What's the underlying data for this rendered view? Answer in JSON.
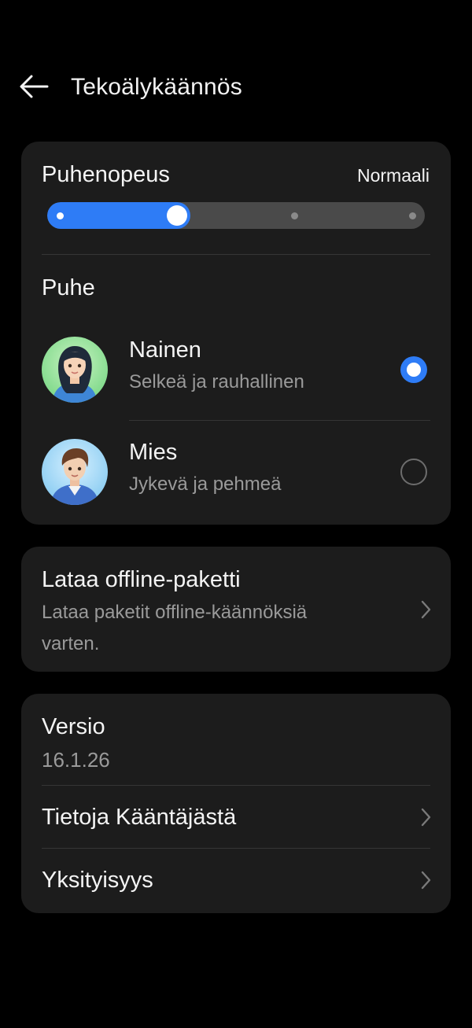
{
  "header": {
    "title": "Tekoälykäännös"
  },
  "speech_rate": {
    "label": "Puhenopeus",
    "value_label": "Normaali",
    "steps": 4,
    "selected_step": 2
  },
  "voice": {
    "label": "Puhe",
    "options": [
      {
        "name": "Nainen",
        "description": "Selkeä ja rauhallinen",
        "selected": true
      },
      {
        "name": "Mies",
        "description": "Jykevä ja pehmeä",
        "selected": false
      }
    ]
  },
  "offline": {
    "title": "Lataa offline-paketti",
    "subtitle_line1": "Lataa paketit offline-käännöksiä",
    "subtitle_line2": "varten."
  },
  "about": {
    "version_label": "Versio",
    "version_value": "16.1.26",
    "translator_info": "Tietoja Kääntäjästä",
    "privacy": "Yksityisyys"
  },
  "colors": {
    "accent": "#2e7cf6",
    "card": "#1c1c1c",
    "background": "#000000"
  }
}
